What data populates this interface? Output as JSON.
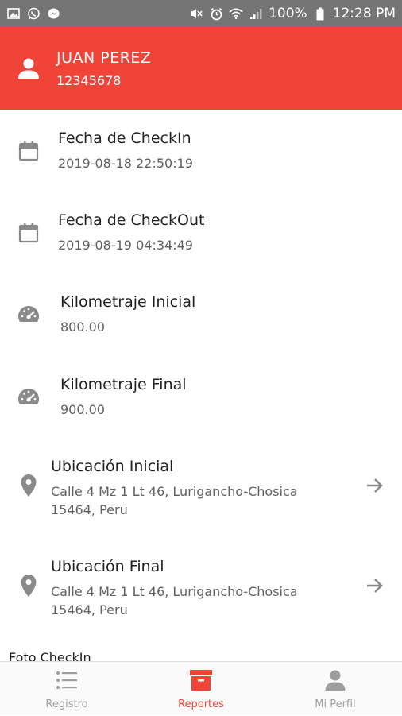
{
  "status_bar": {
    "left_icons": [
      "image-icon",
      "whatsapp-icon",
      "messenger-icon"
    ],
    "right_icons": [
      "mute-icon",
      "alarm-icon",
      "wifi-icon",
      "signal-icon",
      "battery-icon"
    ],
    "battery": "100%",
    "time": "12:28 PM"
  },
  "colors": {
    "accent": "#f04439",
    "status_bar": "#757575",
    "icon": "#8a8a8a",
    "text": "#212121",
    "subtext": "#616161",
    "nav_inactive": "#9e9e9e"
  },
  "header": {
    "name": "JUAN PEREZ",
    "id_number": "12345678",
    "icon": "person-icon"
  },
  "details": [
    {
      "icon": "calendar-icon",
      "title": "Fecha de CheckIn",
      "lines": [
        "2019-08-18 22:50:19"
      ]
    },
    {
      "icon": "calendar-icon",
      "title": "Fecha de CheckOut",
      "lines": [
        "2019-08-19 04:34:49"
      ]
    },
    {
      "icon": "speedometer-icon",
      "title": "Kilometraje Inicial",
      "lines": [
        "800.00"
      ]
    },
    {
      "icon": "speedometer-icon",
      "title": "Kilometraje Final",
      "lines": [
        "900.00"
      ]
    },
    {
      "icon": "location-pin-icon",
      "title": "Ubicación Inicial",
      "lines": [
        "Calle 4 Mz 1 Lt 46, Lurigancho-Chosica",
        "15464, Peru"
      ],
      "action_icon": "arrow-right-icon"
    },
    {
      "icon": "location-pin-icon",
      "title": "Ubicación Final",
      "lines": [
        "Calle 4 Mz 1 Lt 46, Lurigancho-Chosica",
        "15464, Peru"
      ],
      "action_icon": "arrow-right-icon"
    }
  ],
  "section": {
    "foto_checkin": "Foto CheckIn"
  },
  "bottom_nav": [
    {
      "label": "Registro",
      "icon": "list-icon",
      "active": false
    },
    {
      "label": "Reportes",
      "icon": "archive-icon",
      "active": true
    },
    {
      "label": "Mi Perfil",
      "icon": "person-icon",
      "active": false
    }
  ]
}
